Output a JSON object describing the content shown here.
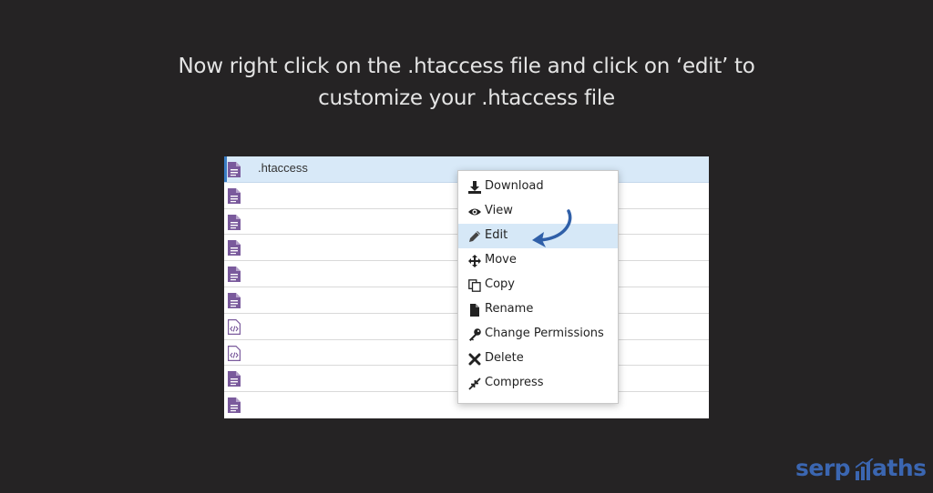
{
  "instruction": {
    "line1": "Now right click on the .htaccess file and click on ‘edit’ to",
    "line2": "customize your .htaccess file"
  },
  "files": [
    {
      "name": ".htaccess",
      "icon": "text-file-icon",
      "selected": true
    },
    {
      "name": "",
      "icon": "text-file-icon"
    },
    {
      "name": "",
      "icon": "text-file-icon"
    },
    {
      "name": "",
      "icon": "text-file-icon"
    },
    {
      "name": "",
      "icon": "text-file-icon"
    },
    {
      "name": "",
      "icon": "text-file-icon"
    },
    {
      "name": "",
      "icon": "code-file-icon"
    },
    {
      "name": "",
      "icon": "code-file-icon"
    },
    {
      "name": "",
      "icon": "text-file-icon"
    },
    {
      "name": "",
      "icon": "text-file-icon"
    }
  ],
  "context_menu": {
    "items": [
      {
        "label": "Download",
        "icon": "download-icon"
      },
      {
        "label": "View",
        "icon": "eye-icon"
      },
      {
        "label": "Edit",
        "icon": "pencil-icon",
        "highlighted": true
      },
      {
        "label": "Move",
        "icon": "move-icon"
      },
      {
        "label": "Copy",
        "icon": "copy-icon"
      },
      {
        "label": "Rename",
        "icon": "file-icon"
      },
      {
        "label": "Change Permissions",
        "icon": "key-icon"
      },
      {
        "label": "Delete",
        "icon": "x-icon"
      },
      {
        "label": "Compress",
        "icon": "compress-icon"
      }
    ]
  },
  "logo": {
    "part1": "serp",
    "part2": "aths"
  },
  "colors": {
    "background": "#252324",
    "file_icon": "#7a5a9c",
    "selected_row": "#d8e9f8",
    "menu_highlight": "#d6e8f7",
    "arrow": "#2f5fa8",
    "logo": "#3b66b1"
  }
}
